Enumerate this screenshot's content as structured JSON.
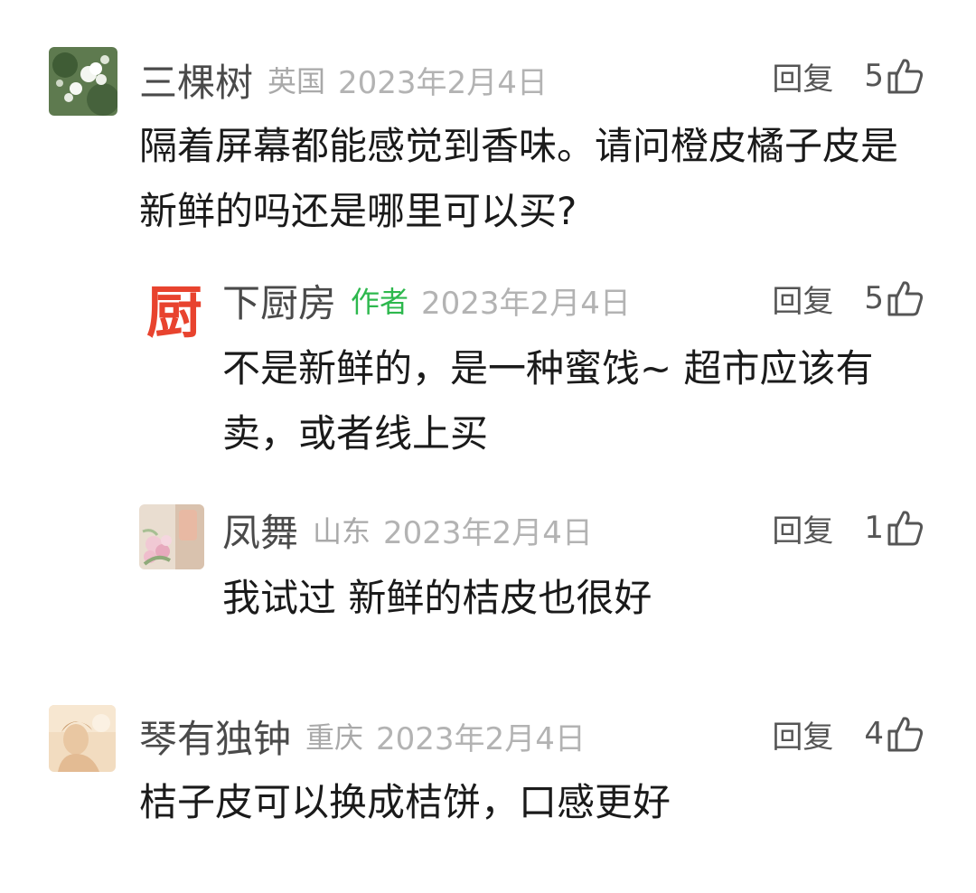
{
  "comments": [
    {
      "avatar": "flower-photo",
      "username": "三棵树",
      "location": "英国",
      "date": "2023年2月4日",
      "reply_label": "回复",
      "likes": "5",
      "text": "隔着屏幕都能感觉到香味。请问橙皮橘子皮是新鲜的吗还是哪里可以买?"
    },
    {
      "avatar": "kitchen-logo",
      "avatar_text": "厨",
      "username": "下厨房",
      "author_tag": "作者",
      "date": "2023年2月4日",
      "reply_label": "回复",
      "likes": "5",
      "text": "不是新鲜的，是一种蜜饯~ 超市应该有卖，或者线上买"
    },
    {
      "avatar": "flowers-photo",
      "username": "凤舞",
      "location": "山东",
      "date": "2023年2月4日",
      "reply_label": "回复",
      "likes": "1",
      "text": "我试过 新鲜的桔皮也很好"
    },
    {
      "avatar": "portrait-photo",
      "username": "琴有独钟",
      "location": "重庆",
      "date": "2023年2月4日",
      "reply_label": "回复",
      "likes": "4",
      "text": "桔子皮可以换成桔饼，口感更好"
    }
  ],
  "colors": {
    "author_tag": "#2db84d",
    "logo_red": "#e8432e",
    "muted_text": "#a9a9a9",
    "body_text": "#1a1a1a"
  }
}
